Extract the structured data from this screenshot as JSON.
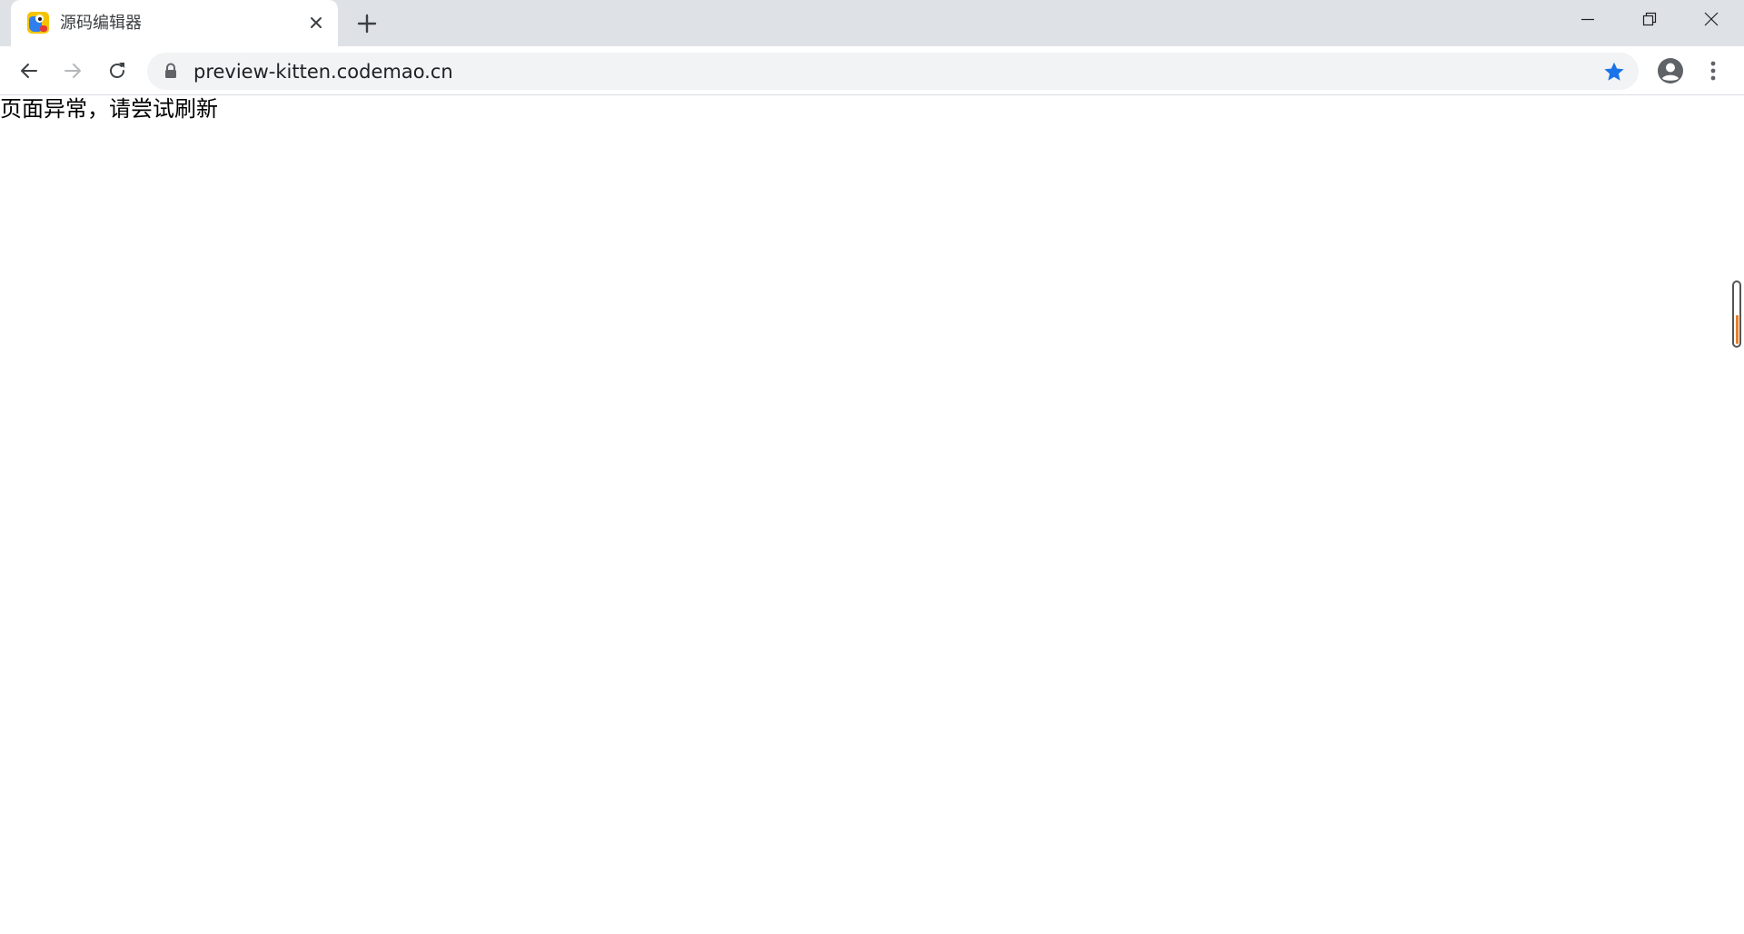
{
  "tab": {
    "title": "源码编辑器",
    "favicon": "codemao-app-icon"
  },
  "toolbar": {
    "url": "preview-kitten.codemao.cn",
    "bookmark_starred": true,
    "accent_color": "#1a73e8"
  },
  "content": {
    "message": "页面异常，请尝试刷新"
  },
  "icons": {
    "close": "close-icon",
    "new_tab": "plus-icon",
    "back": "arrow-left-icon",
    "forward": "arrow-right-icon",
    "reload": "reload-icon",
    "lock": "lock-icon",
    "star": "star-icon",
    "profile": "account-circle-icon",
    "menu": "kebab-menu-icon",
    "minimize": "minimize-icon",
    "restore": "restore-icon",
    "window_close": "window-close-icon"
  }
}
